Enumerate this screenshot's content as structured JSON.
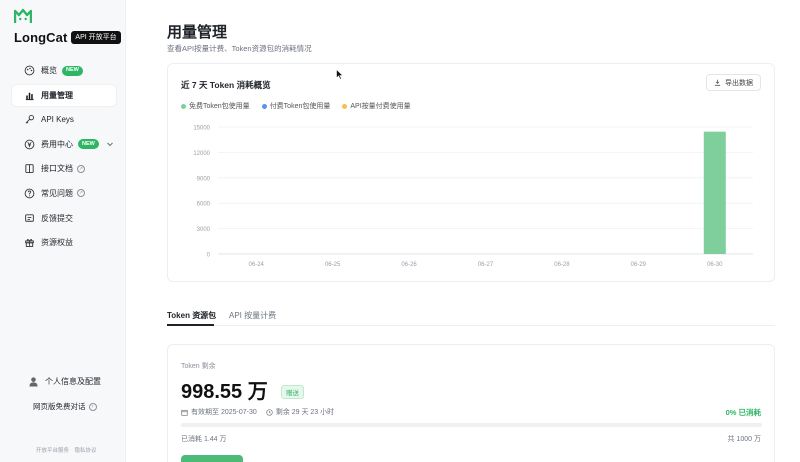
{
  "brand": {
    "name": "LongCat",
    "badge": "API 开放平台",
    "accent": "#2fb664"
  },
  "sidebar": {
    "items": [
      {
        "label": "概览",
        "icon": "palette-icon",
        "badge": "NEW"
      },
      {
        "label": "用量管理",
        "icon": "bar-chart-icon",
        "active": true
      },
      {
        "label": "API Keys",
        "icon": "key-icon"
      },
      {
        "label": "费用中心",
        "icon": "money-icon",
        "badge": "NEW",
        "expandable": true
      },
      {
        "label": "接口文档",
        "icon": "book-icon",
        "external": true
      },
      {
        "label": "常见问题",
        "icon": "help-icon",
        "external": true
      },
      {
        "label": "反馈提交",
        "icon": "feedback-icon"
      },
      {
        "label": "资源权益",
        "icon": "gift-icon"
      }
    ],
    "profile_label": "个人信息及配置",
    "free_link": "网页版免费对话",
    "footer": [
      "开放平台服务",
      "隐私协议"
    ]
  },
  "page": {
    "title": "用量管理",
    "subtitle": "查看API按量计费、Token资源包的消耗情况"
  },
  "chart_card": {
    "title": "近 7 天 Token 消耗概览",
    "export_label": "导出数据"
  },
  "chart_data": {
    "type": "bar",
    "categories": [
      "06-24",
      "06-25",
      "06-26",
      "06-27",
      "06-28",
      "06-29",
      "06-30"
    ],
    "series": [
      {
        "name": "免费Token包使用量",
        "color": "#7fcf9c",
        "values": [
          0,
          0,
          0,
          0,
          0,
          0,
          14450
        ]
      },
      {
        "name": "付费Token包使用量",
        "color": "#5b8ff9",
        "values": [
          0,
          0,
          0,
          0,
          0,
          0,
          0
        ]
      },
      {
        "name": "API按量付费使用量",
        "color": "#f6c244",
        "values": [
          0,
          0,
          0,
          0,
          0,
          0,
          0
        ]
      }
    ],
    "yticks": [
      0,
      3000,
      6000,
      9000,
      12000,
      15000
    ],
    "ylim": [
      0,
      15000
    ],
    "grid": true,
    "legend": "top-left"
  },
  "tabs": [
    {
      "label": "Token 资源包",
      "active": true
    },
    {
      "label": "API 按量计费",
      "active": false
    }
  ],
  "resource": {
    "label": "Token 剩余",
    "amount": "998.55 万",
    "tag": "赠送",
    "expiry": "有效期至 2025-07-30",
    "remaining": "剩余 29 天 23 小时",
    "used_pct_label": "0% 已消耗",
    "used_fraction": 0.0,
    "used": "已消耗 1.44 万",
    "total": "共 1000 万"
  }
}
